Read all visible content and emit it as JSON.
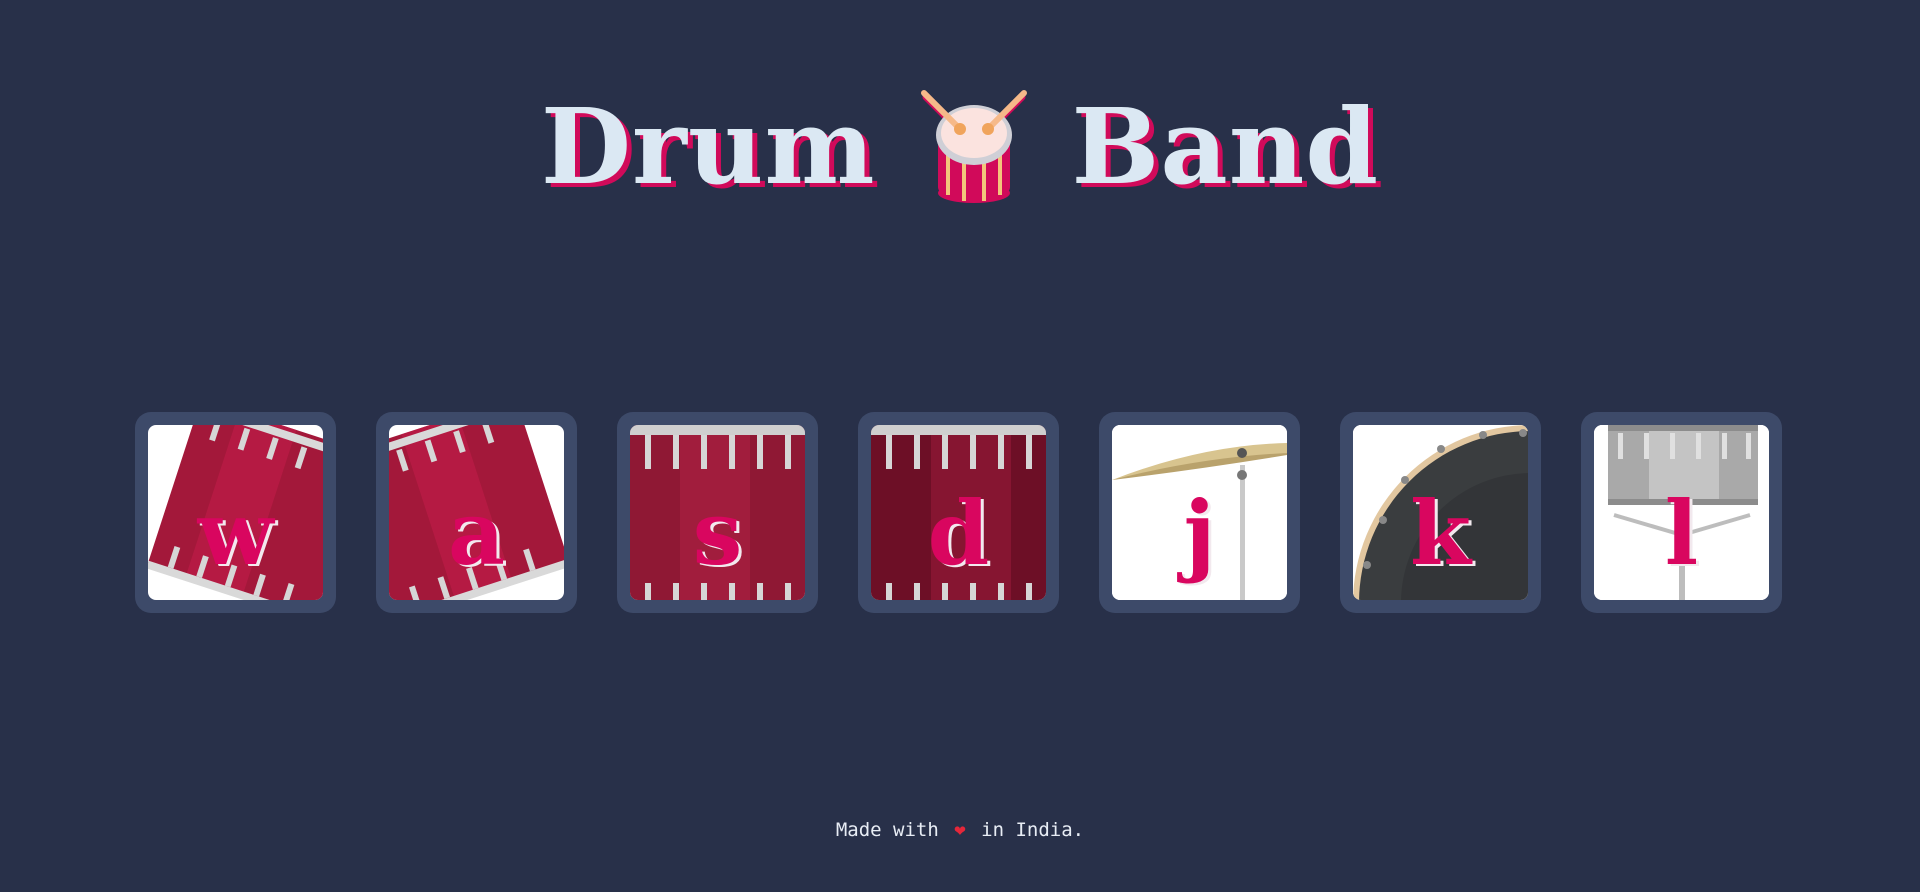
{
  "header": {
    "title_left": "Drum",
    "title_right": "Band",
    "logo_icon": "drum-with-sticks-icon"
  },
  "drums": [
    {
      "key": "w",
      "instrument": "tom-1",
      "icon": "tom-drum-tilted-left-icon"
    },
    {
      "key": "a",
      "instrument": "tom-2",
      "icon": "tom-drum-tilted-right-icon"
    },
    {
      "key": "s",
      "instrument": "tom-3",
      "icon": "tom-drum-icon"
    },
    {
      "key": "d",
      "instrument": "tom-4",
      "icon": "tom-drum-icon"
    },
    {
      "key": "j",
      "instrument": "crash",
      "icon": "cymbal-icon"
    },
    {
      "key": "k",
      "instrument": "kick-bass",
      "icon": "kick-drum-icon"
    },
    {
      "key": "l",
      "instrument": "snare",
      "icon": "snare-drum-icon"
    }
  ],
  "footer": {
    "prefix": "Made with",
    "heart": "❤",
    "suffix": "in India."
  },
  "colors": {
    "background": "#283049",
    "tile": "#3d4a69",
    "title_text": "#dbe8f3",
    "accent": "#d10a5a",
    "drum_red": "#a3183a"
  }
}
